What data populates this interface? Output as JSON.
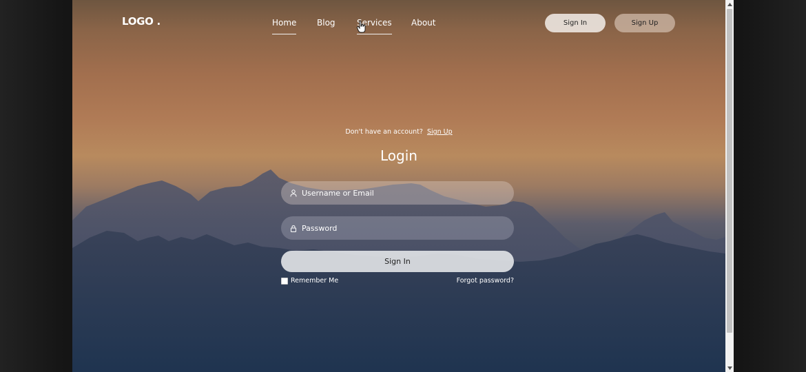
{
  "nav": {
    "logo": "LOGO .",
    "links": [
      "Home",
      "Blog",
      "Services",
      "About"
    ],
    "sign_in": "Sign In",
    "sign_up": "Sign Up"
  },
  "login": {
    "no_account_text": "Don't have an account?",
    "sign_up_link": "Sign Up",
    "title": "Login",
    "username_placeholder": "Username or Email",
    "password_placeholder": "Password",
    "submit": "Sign In",
    "remember_me": "Remember Me",
    "forgot_password": "Forgot password?"
  },
  "icons": {
    "username": "user-icon",
    "password": "lock-icon"
  },
  "colors": {
    "sky_top": "#6e5640",
    "sky_mid": "#b88a5e",
    "mountain_far": "#4b5168",
    "mountain_near": "#2a3a55",
    "sign_in_button": "#e9e2db",
    "sign_up_button": "#cbb4a3"
  }
}
